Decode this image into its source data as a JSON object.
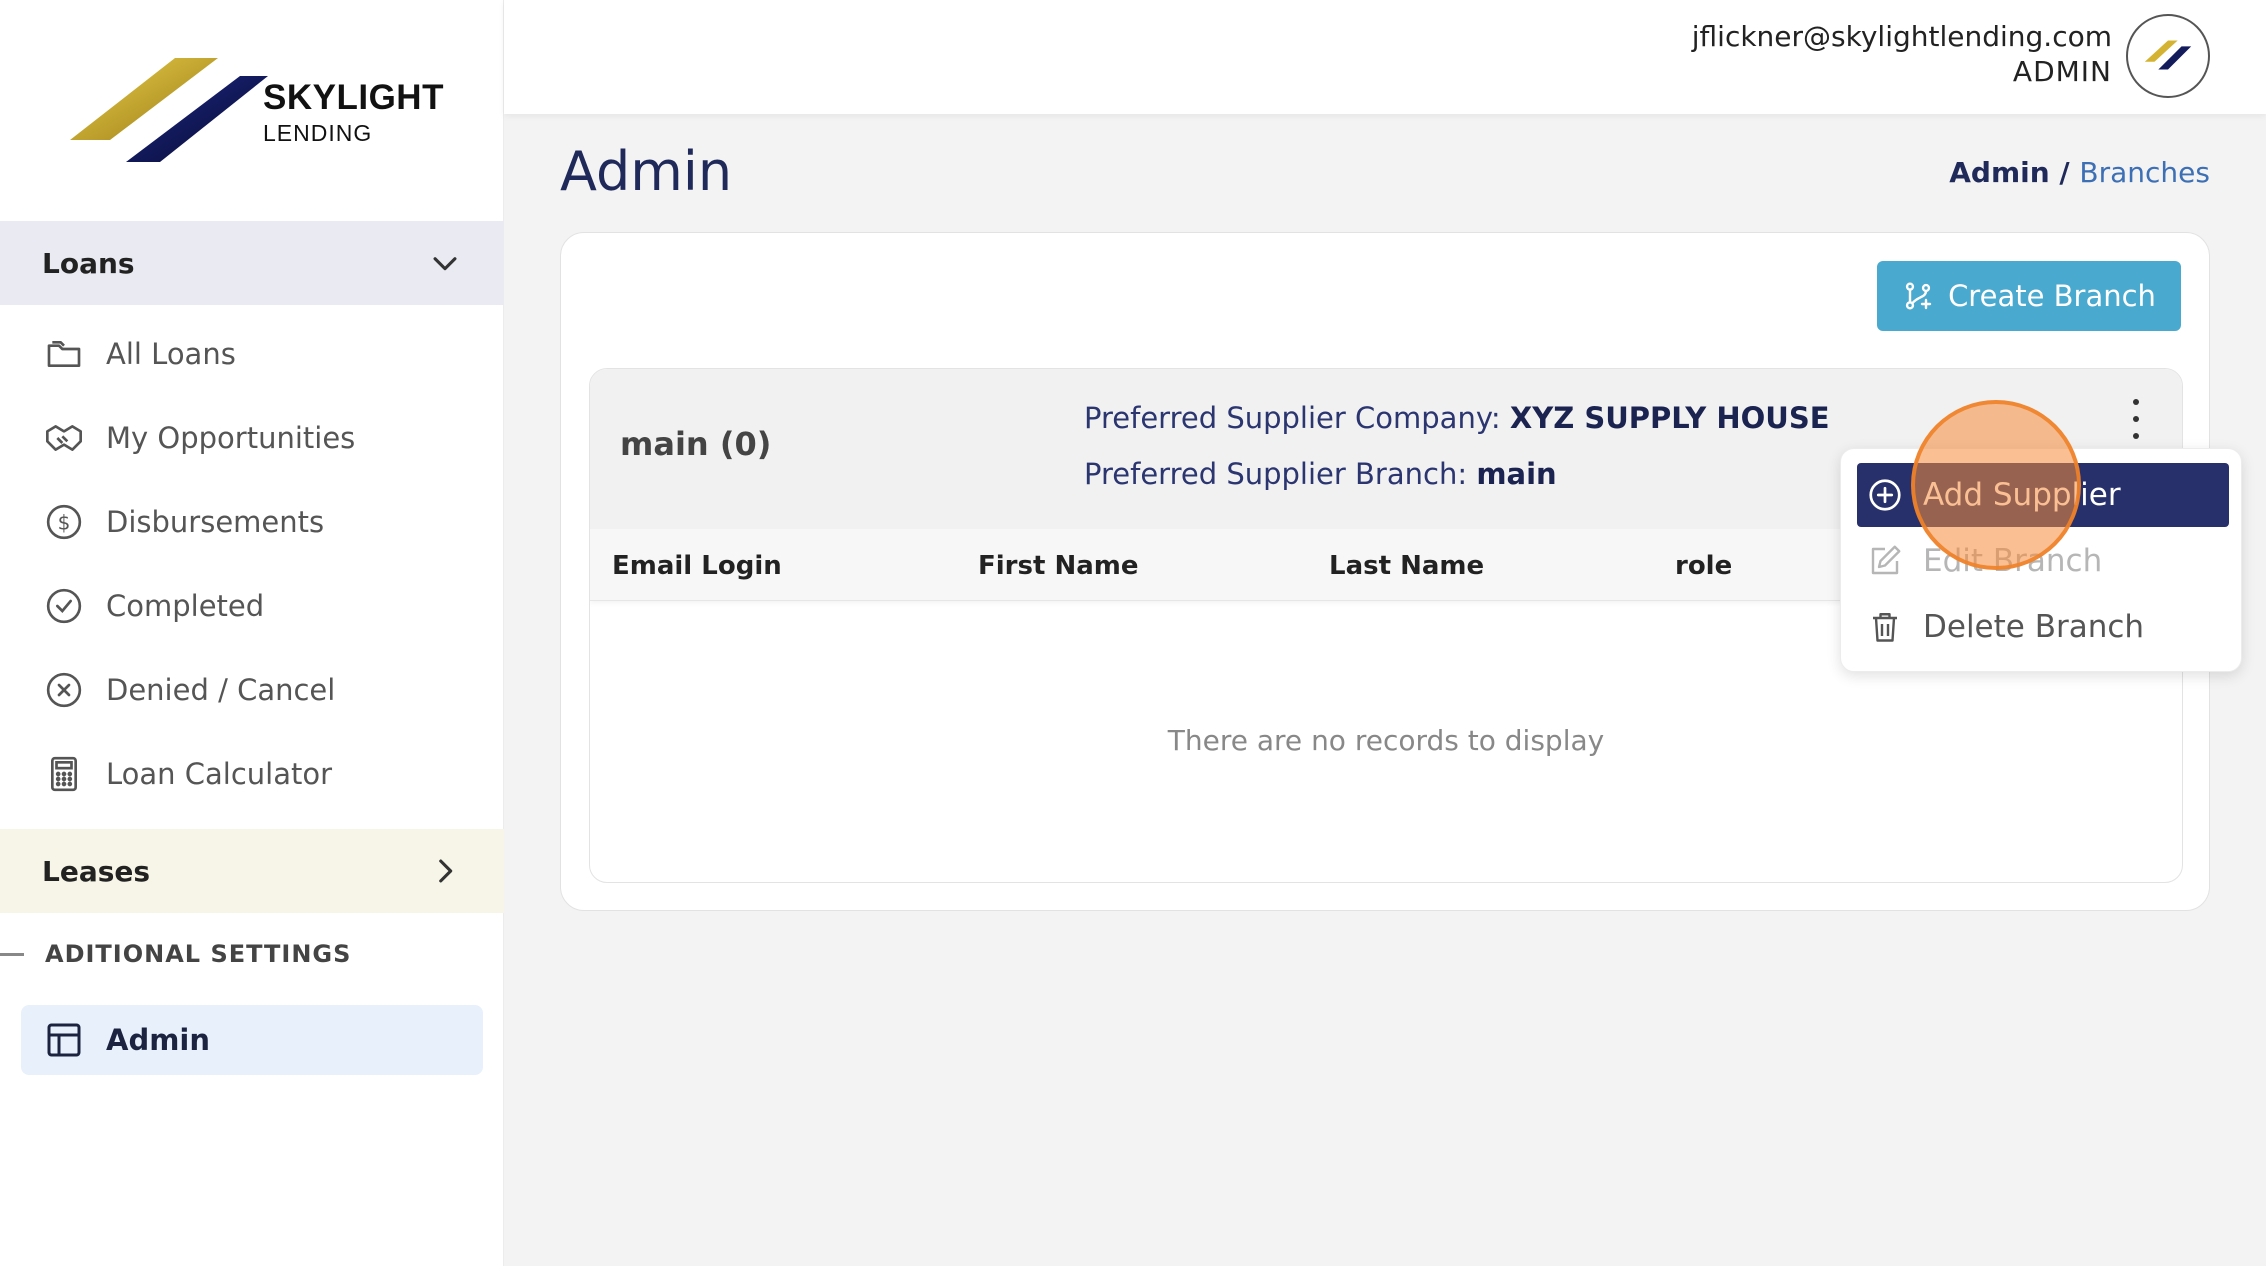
{
  "brand": {
    "name": "SKYLIGHT",
    "subtitle": "LENDING",
    "colors": {
      "gold": "#c9a227",
      "navy": "#141c5c"
    }
  },
  "user": {
    "email": "jflickner@skylightlending.com",
    "role": "ADMIN"
  },
  "sidebar": {
    "loans_section": {
      "label": "Loans",
      "icon": "chevron-down-icon"
    },
    "items": [
      {
        "label": "All Loans",
        "icon": "folder-icon"
      },
      {
        "label": "My Opportunities",
        "icon": "handshake-icon"
      },
      {
        "label": "Disbursements",
        "icon": "dollar-circle-icon"
      },
      {
        "label": "Completed",
        "icon": "check-circle-icon"
      },
      {
        "label": "Denied / Cancel",
        "icon": "x-circle-icon"
      },
      {
        "label": "Loan Calculator",
        "icon": "calculator-icon"
      }
    ],
    "leases_section": {
      "label": "Leases",
      "icon": "chevron-right-icon"
    },
    "settings_label": "ADITIONAL SETTINGS",
    "admin_item": {
      "label": "Admin",
      "icon": "layout-icon"
    }
  },
  "page": {
    "title": "Admin",
    "breadcrumb": {
      "current": "Admin",
      "separator": " / ",
      "link": "Branches"
    }
  },
  "card": {
    "create_button": "Create Branch",
    "branch": {
      "name": "main (0)",
      "pref_company_label": "Preferred Supplier Company: ",
      "pref_company_value": "XYZ SUPPLY HOUSE",
      "pref_branch_label": "Preferred Supplier Branch: ",
      "pref_branch_value": "main"
    },
    "table": {
      "columns": [
        "Email Login",
        "First Name",
        "Last Name",
        "role"
      ],
      "empty_message": "There are no records to display"
    }
  },
  "menu": {
    "items": [
      {
        "label": "Add Supplier",
        "icon": "plus-circle-icon",
        "state": "active"
      },
      {
        "label": "Edit Branch",
        "icon": "edit-icon",
        "state": "disabled"
      },
      {
        "label": "Delete Branch",
        "icon": "trash-icon",
        "state": "normal"
      }
    ]
  },
  "colors": {
    "accent": "#4aa9cf",
    "primary_text": "#1f2a5a",
    "menu_active_bg": "#27306b",
    "click_indicator": "#f58c3c"
  }
}
